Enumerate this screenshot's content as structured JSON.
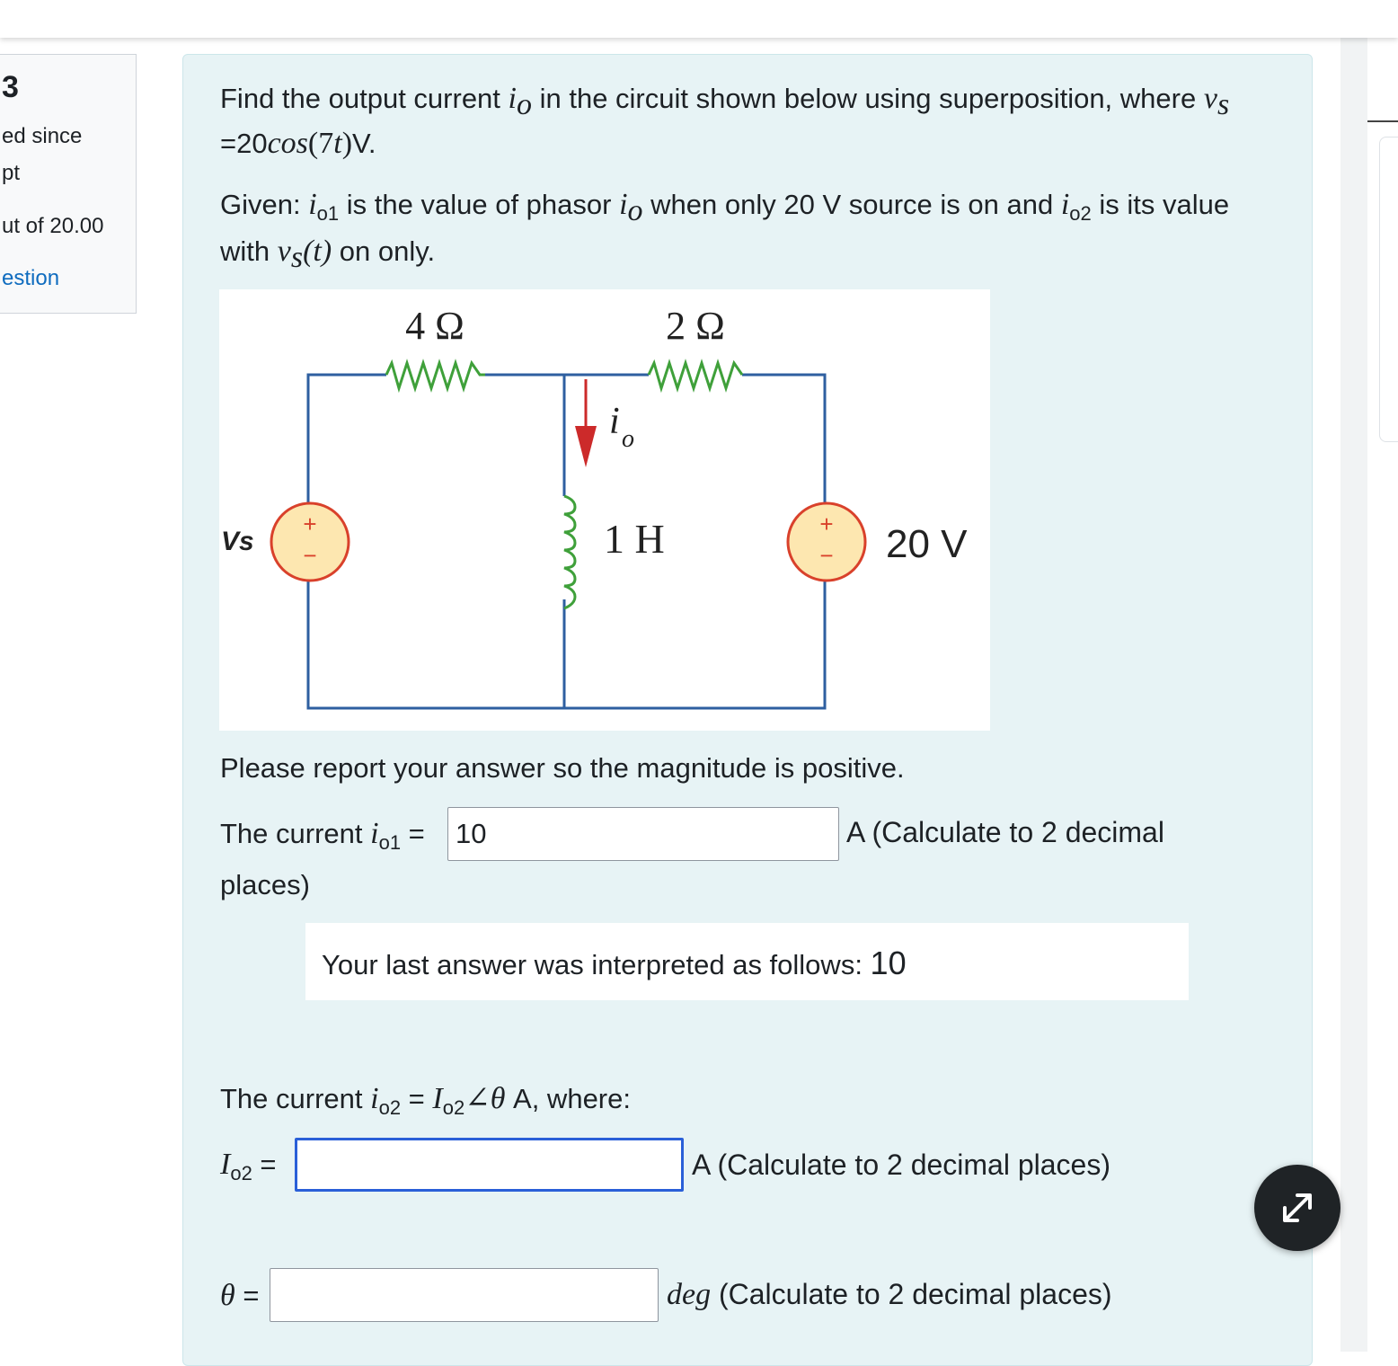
{
  "sidebar": {
    "question_number": "3",
    "line1": "ed since",
    "line2": "pt",
    "line3": "ut of 20.00",
    "link": "estion"
  },
  "question": {
    "line1_a": "Find the output current ",
    "line1_var": "i",
    "line1_sub": "o",
    "line1_b": " in the circuit shown below using superposition, where ",
    "line1_var2": "v",
    "line1_sub2": "s",
    "line2_a": "=20",
    "line2_cos": "cos",
    "line2_paren": "(7",
    "line2_t": "t",
    "line2_close": ")",
    "line2_unit": "V.",
    "given_a": "Given: ",
    "given_sub1": "o1",
    "given_b": " is the value of phasor ",
    "given_c": " when only 20 V source is on and ",
    "given_sub2": "o2",
    "given_d": " is its value",
    "given2_a": "with ",
    "given2_t": "(t)",
    "given2_b": " on only.",
    "report": "Please report your answer so the magnitude is positive."
  },
  "circuit": {
    "r1_label": "4 Ω",
    "r2_label": "2 Ω",
    "inductor_label": "1 H",
    "source_left_label": "Vs",
    "source_right_label": "20 V",
    "current_label": "i",
    "current_sub": "o",
    "plus": "+",
    "minus": "−"
  },
  "part1": {
    "prefix": "The current ",
    "var": "i",
    "sub": "o1",
    "eq": " = ",
    "value": "10",
    "suffix": "A (Calculate to 2 decimal",
    "suffix2": "places)",
    "interp_label": "Your last answer was interpreted as follows: ",
    "interp_value": "10"
  },
  "part2": {
    "prefix": "The current ",
    "var": "i",
    "sub": "o2",
    "eq": " = ",
    "mag_var": "I",
    "mag_sub": "o2",
    "angle": "∠",
    "theta": "θ",
    "suffix": " A, where:",
    "i_label_var": "I",
    "i_label_sub": "o2",
    "i_label_eq": " =",
    "i_value": "",
    "i_unit": "A (Calculate to 2 decimal places)",
    "theta_label": "θ",
    "theta_eq": " =",
    "theta_value": "",
    "theta_unit_var": "deg",
    "theta_unit": " (Calculate to 2 decimal places)"
  },
  "colors": {
    "panel_bg": "#e7f3f5",
    "wire": "#2e5fa0",
    "source_fill": "#fde7b0",
    "source_stroke": "#d9412b",
    "arrow": "#cc2a2a",
    "link": "#0f6cbf",
    "focus_border": "#2a5fd8"
  },
  "icons": {
    "expand": "expand-icon"
  }
}
